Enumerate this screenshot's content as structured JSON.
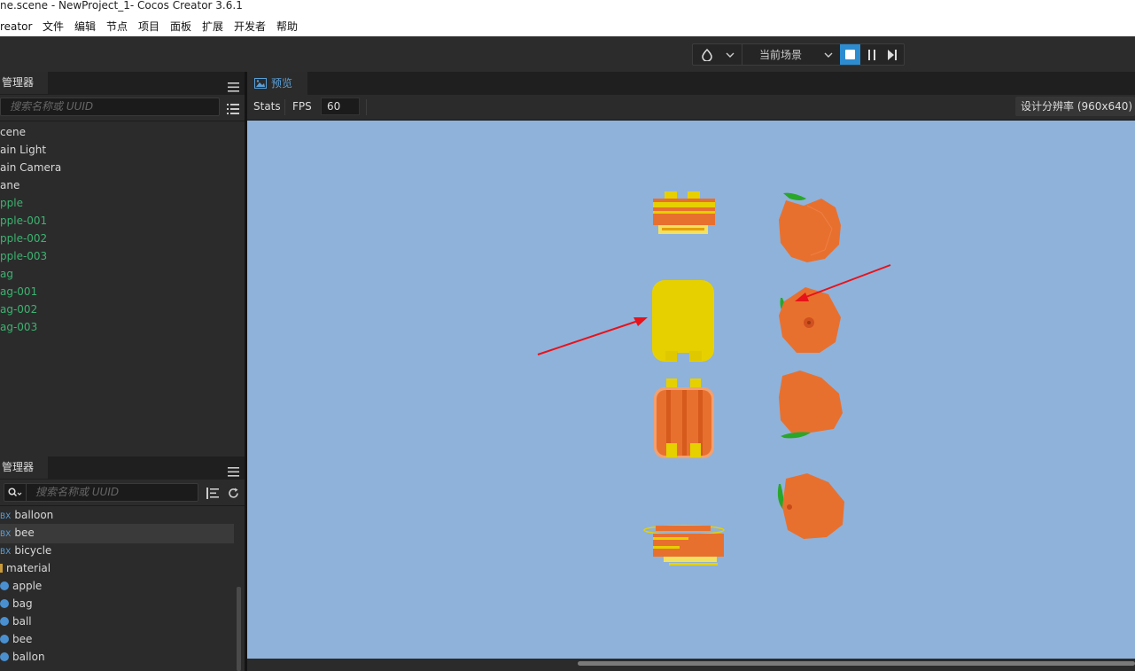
{
  "window": {
    "title": "ne.scene - NewProject_1- Cocos Creator 3.6.1"
  },
  "menu": [
    "reator",
    "文件",
    "编辑",
    "节点",
    "项目",
    "面板",
    "扩展",
    "开发者",
    "帮助"
  ],
  "toolbar": {
    "scene_select": "当前场景"
  },
  "hierarchy": {
    "tab_label": "管理器",
    "search_placeholder": "搜索名称或 UUID",
    "nodes": [
      {
        "label": "cene",
        "prefab": false
      },
      {
        "label": "ain Light",
        "prefab": false
      },
      {
        "label": "ain Camera",
        "prefab": false
      },
      {
        "label": "ane",
        "prefab": false
      },
      {
        "label": "pple",
        "prefab": true
      },
      {
        "label": "pple-001",
        "prefab": true
      },
      {
        "label": "pple-002",
        "prefab": true
      },
      {
        "label": "pple-003",
        "prefab": true
      },
      {
        "label": "ag",
        "prefab": true
      },
      {
        "label": "ag-001",
        "prefab": true
      },
      {
        "label": "ag-002",
        "prefab": true
      },
      {
        "label": "ag-003",
        "prefab": true
      }
    ]
  },
  "assets": {
    "tab_label": "管理器",
    "search_placeholder": "搜索名称或 UUID",
    "fbx_tag": "BX",
    "items": [
      {
        "label": "balloon",
        "kind": "fbx"
      },
      {
        "label": "bee",
        "kind": "fbx",
        "selected": true
      },
      {
        "label": "bicycle",
        "kind": "fbx"
      },
      {
        "label": "material",
        "kind": "folder"
      },
      {
        "label": "apple",
        "kind": "material"
      },
      {
        "label": "bag",
        "kind": "material"
      },
      {
        "label": "ball",
        "kind": "material"
      },
      {
        "label": "bee",
        "kind": "material"
      },
      {
        "label": "ballon",
        "kind": "material"
      }
    ]
  },
  "preview": {
    "tab_label": "预览",
    "stats_label": "Stats",
    "fps_label": "FPS",
    "fps_value": "60",
    "resolution": "设计分辨率 (960x640)"
  },
  "colors": {
    "viewport_bg": "#8fb2da",
    "accent": "#2d8cd0",
    "prefab_green": "#3cb371",
    "apple_orange": "#e8702e",
    "bag_yellow": "#e6d000",
    "arrow_red": "#e8121a"
  }
}
